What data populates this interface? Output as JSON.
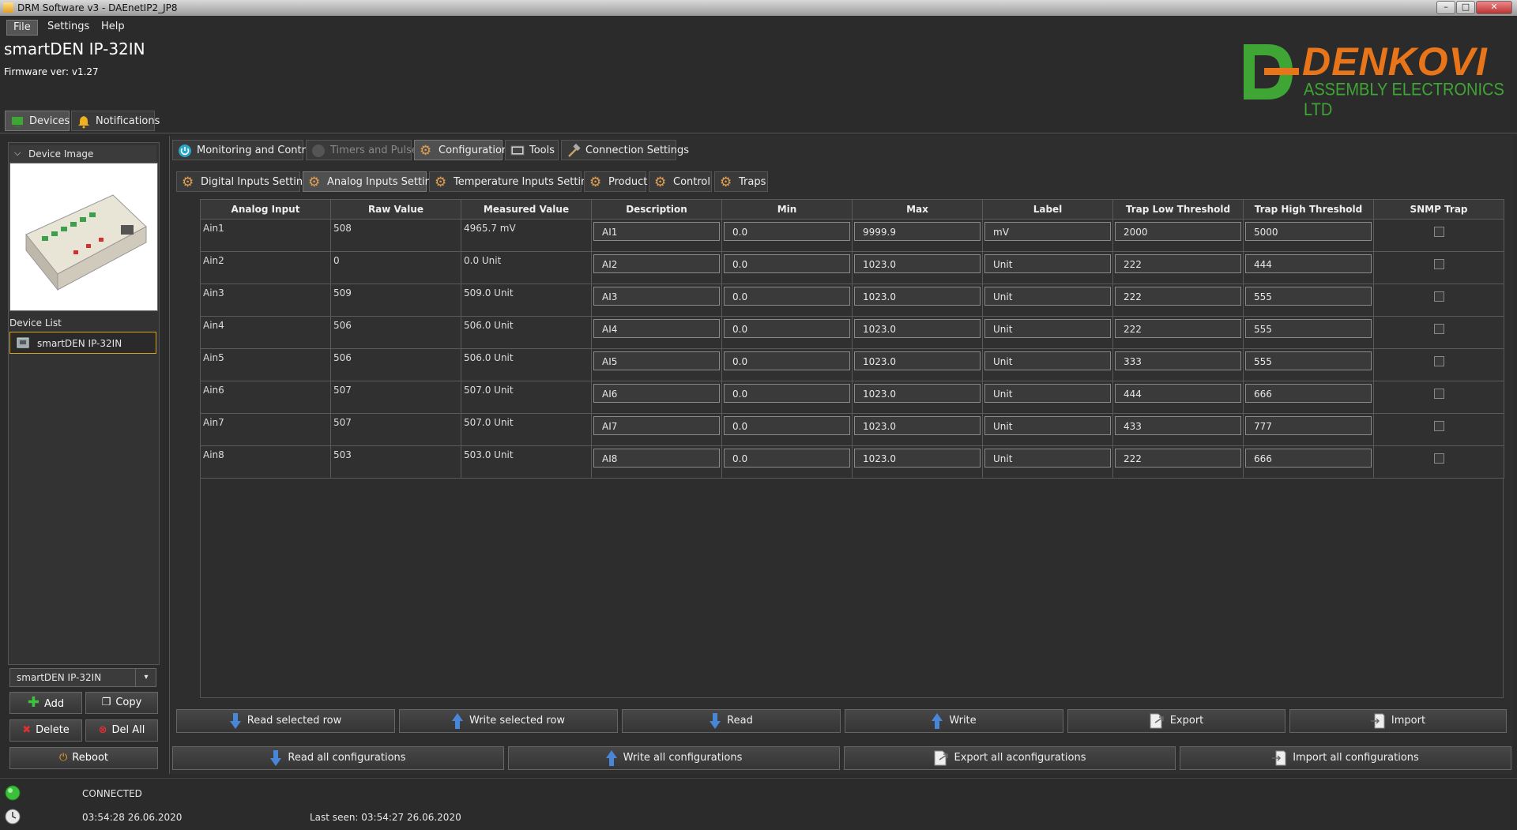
{
  "window": {
    "title": "DRM Software v3 - DAEnetIP2_JP8"
  },
  "menu": [
    "File",
    "Settings",
    "Help"
  ],
  "device": {
    "name": "smartDEN IP-32IN",
    "firmware": "Firmware ver: v1.27"
  },
  "logo": {
    "name": "DENKOVI",
    "sub": "ASSEMBLY ELECTRONICS LTD",
    "green": "#3fa535",
    "orange": "#e8751a"
  },
  "left_tabs": [
    "Devices",
    "Notifications"
  ],
  "main_tabs": [
    "Monitoring and Control",
    "Timers and Pulses",
    "Configuration",
    "Tools",
    "Connection Settings"
  ],
  "sub_tabs": [
    "Digital Inputs Settings",
    "Analog Inputs Settings",
    "Temperature Inputs Settings",
    "Product",
    "Control",
    "Traps"
  ],
  "sidebar": {
    "device_image_label": "Device Image",
    "device_list_label": "Device List",
    "device_list_item": "smartDEN IP-32IN",
    "device_select_value": "smartDEN IP-32IN",
    "buttons": {
      "add": "Add",
      "copy": "Copy",
      "delete": "Delete",
      "del_all": "Del All",
      "reboot": "Reboot"
    }
  },
  "table": {
    "headers": [
      "Analog Input",
      "Raw Value",
      "Measured Value",
      "Description",
      "Min",
      "Max",
      "Label",
      "Trap Low Threshold",
      "Trap High Threshold",
      "SNMP Trap"
    ],
    "rows": [
      {
        "input": "Ain1",
        "raw": "508",
        "measured": "4965.7 mV",
        "description": "AI1",
        "min": "0.0",
        "max": "9999.9",
        "label": "mV",
        "low": "2000",
        "high": "5000"
      },
      {
        "input": "Ain2",
        "raw": "0",
        "measured": "0.0 Unit",
        "description": "AI2",
        "min": "0.0",
        "max": "1023.0",
        "label": "Unit",
        "low": "222",
        "high": "444"
      },
      {
        "input": "Ain3",
        "raw": "509",
        "measured": "509.0 Unit",
        "description": "AI3",
        "min": "0.0",
        "max": "1023.0",
        "label": "Unit",
        "low": "222",
        "high": "555"
      },
      {
        "input": "Ain4",
        "raw": "506",
        "measured": "506.0 Unit",
        "description": "AI4",
        "min": "0.0",
        "max": "1023.0",
        "label": "Unit",
        "low": "222",
        "high": "555"
      },
      {
        "input": "Ain5",
        "raw": "506",
        "measured": "506.0 Unit",
        "description": "AI5",
        "min": "0.0",
        "max": "1023.0",
        "label": "Unit",
        "low": "333",
        "high": "555"
      },
      {
        "input": "Ain6",
        "raw": "507",
        "measured": "507.0 Unit",
        "description": "AI6",
        "min": "0.0",
        "max": "1023.0",
        "label": "Unit",
        "low": "444",
        "high": "666"
      },
      {
        "input": "Ain7",
        "raw": "507",
        "measured": "507.0 Unit",
        "description": "AI7",
        "min": "0.0",
        "max": "1023.0",
        "label": "Unit",
        "low": "433",
        "high": "777"
      },
      {
        "input": "Ain8",
        "raw": "503",
        "measured": "503.0 Unit",
        "description": "AI8",
        "min": "0.0",
        "max": "1023.0",
        "label": "Unit",
        "low": "222",
        "high": "666"
      }
    ]
  },
  "actions": {
    "read_selected": "Read selected row",
    "write_selected": "Write selected row",
    "read": "Read",
    "write": "Write",
    "export": "Export",
    "import": "Import",
    "read_all": "Read all configurations",
    "write_all": "Write all configurations",
    "export_all": "Export all aconfigurations",
    "import_all": "Import all configurations"
  },
  "status": {
    "connection": "CONNECTED",
    "time": "03:54:28 26.06.2020",
    "last_seen": "Last seen: 03:54:27 26.06.2020"
  },
  "colors": {
    "accent_blue": "#4a86d8",
    "connected_green": "#3cc03c",
    "selection_border": "#d4a21a"
  }
}
